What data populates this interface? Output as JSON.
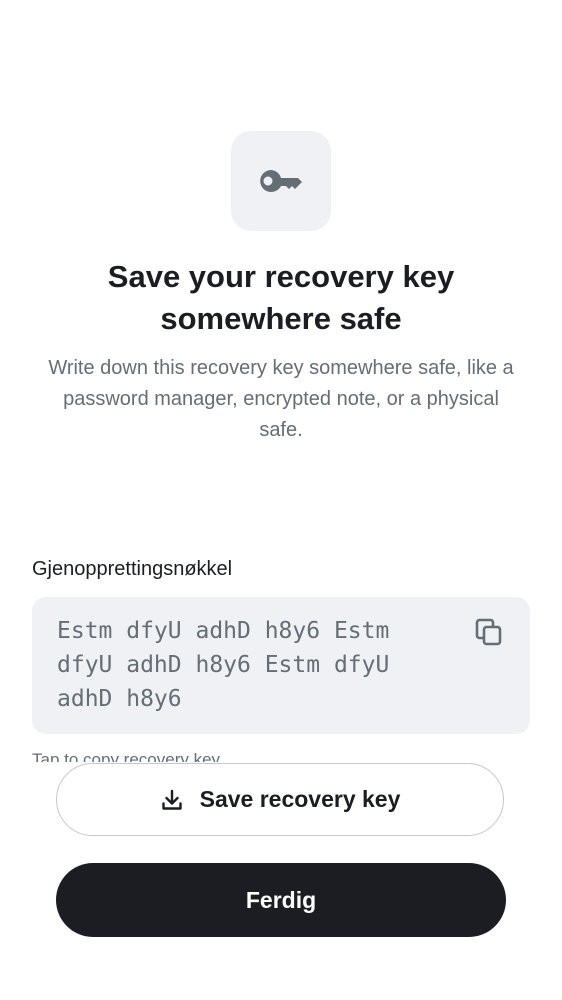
{
  "header": {
    "icon": "key-icon",
    "title": "Save your recovery key somewhere safe",
    "subtitle": "Write down this recovery key somewhere safe, like a password manager, encrypted note, or a physical safe."
  },
  "recovery_key": {
    "label": "Gjenopprettingsnøkkel",
    "value": "Estm dfyU adhD h8y6 Estm dfyU adhD h8y6 Estm dfyU adhD h8y6",
    "copy_icon": "copy-icon",
    "hint": "Tap to copy recovery key"
  },
  "actions": {
    "save_label": "Save recovery key",
    "save_icon": "download-icon",
    "done_label": "Ferdig"
  },
  "colors": {
    "accent": "#1b1d22",
    "secondary_text": "#656d77",
    "surface": "#f0f1f4",
    "border": "#c5c8ce"
  }
}
